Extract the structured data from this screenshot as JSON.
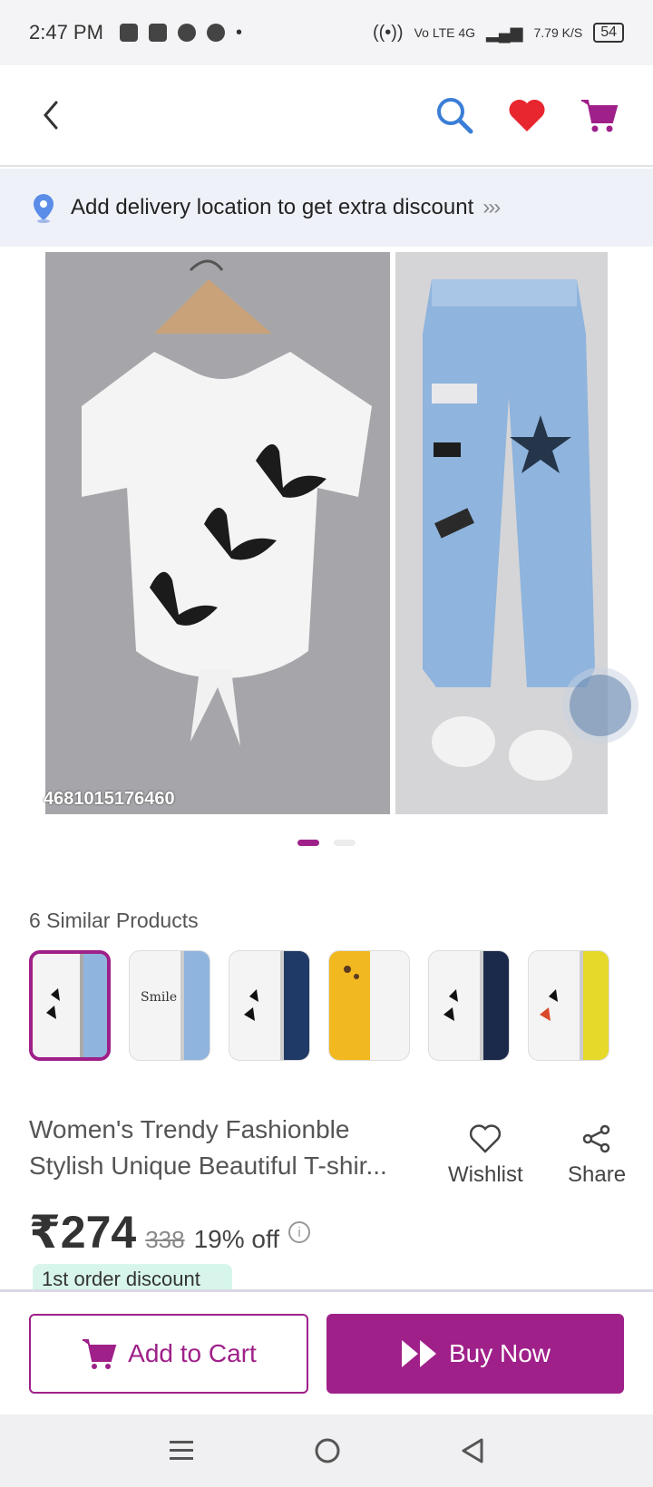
{
  "statusbar": {
    "time": "2:47 PM",
    "network": "Vo LTE 4G",
    "speed": "7.79 K/S",
    "battery": "54"
  },
  "header": {
    "icons": [
      "back-icon",
      "search-icon",
      "heart-icon",
      "cart-icon"
    ]
  },
  "delivery": {
    "text": "Add delivery location to get extra discount",
    "chevrons": "›››"
  },
  "gallery": {
    "sku_text": "4681015176460"
  },
  "similar": {
    "title": "6 Similar Products",
    "thumbs": [
      "tee-butterfly-jeans",
      "tee-smile-jeans",
      "tee-butterfly-dark-jeans",
      "tee-yellow-set",
      "tee-butterfly-navy-jeans",
      "tee-butterfly-yellow"
    ]
  },
  "product": {
    "title_line1": "Women's Trendy Fashionble",
    "title_line2": "Stylish Unique Beautiful T-shir...",
    "wishlist": "Wishlist",
    "share": "Share",
    "price": "₹274",
    "mrp": "338",
    "off": "19% off",
    "tag": "1st order discount"
  },
  "actions": {
    "add_to_cart": "Add to Cart",
    "buy_now": "Buy Now"
  },
  "colors": {
    "brand": "#9f2089",
    "wishlist_red": "#e8262f",
    "search_blue": "#3b7ed6"
  }
}
